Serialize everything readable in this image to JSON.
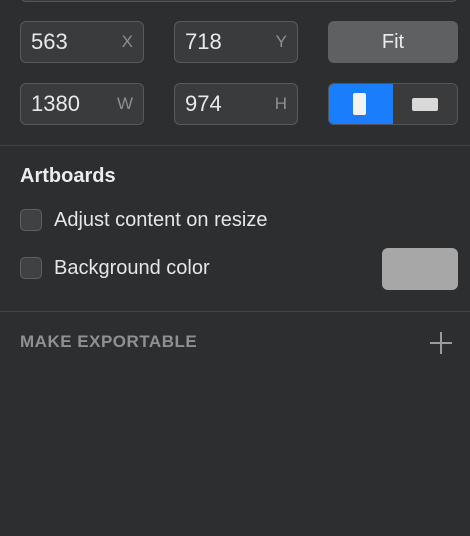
{
  "geometry": {
    "x": {
      "value": "563",
      "unit": "X"
    },
    "y": {
      "value": "718",
      "unit": "Y"
    },
    "w": {
      "value": "1380",
      "unit": "W"
    },
    "h": {
      "value": "974",
      "unit": "H"
    },
    "fit_label": "Fit",
    "orientation": {
      "selected": "portrait",
      "options": [
        "portrait",
        "landscape"
      ]
    }
  },
  "artboards": {
    "title": "Artboards",
    "adjust_content": {
      "label": "Adjust content on resize",
      "checked": false
    },
    "background_color": {
      "label": "Background color",
      "checked": false,
      "swatch": "#a7a7a7"
    }
  },
  "export": {
    "title": "MAKE EXPORTABLE"
  },
  "colors": {
    "panel_bg": "#2d2e30",
    "accent": "#1a7dfb",
    "field_bg": "#3a3b3d"
  }
}
